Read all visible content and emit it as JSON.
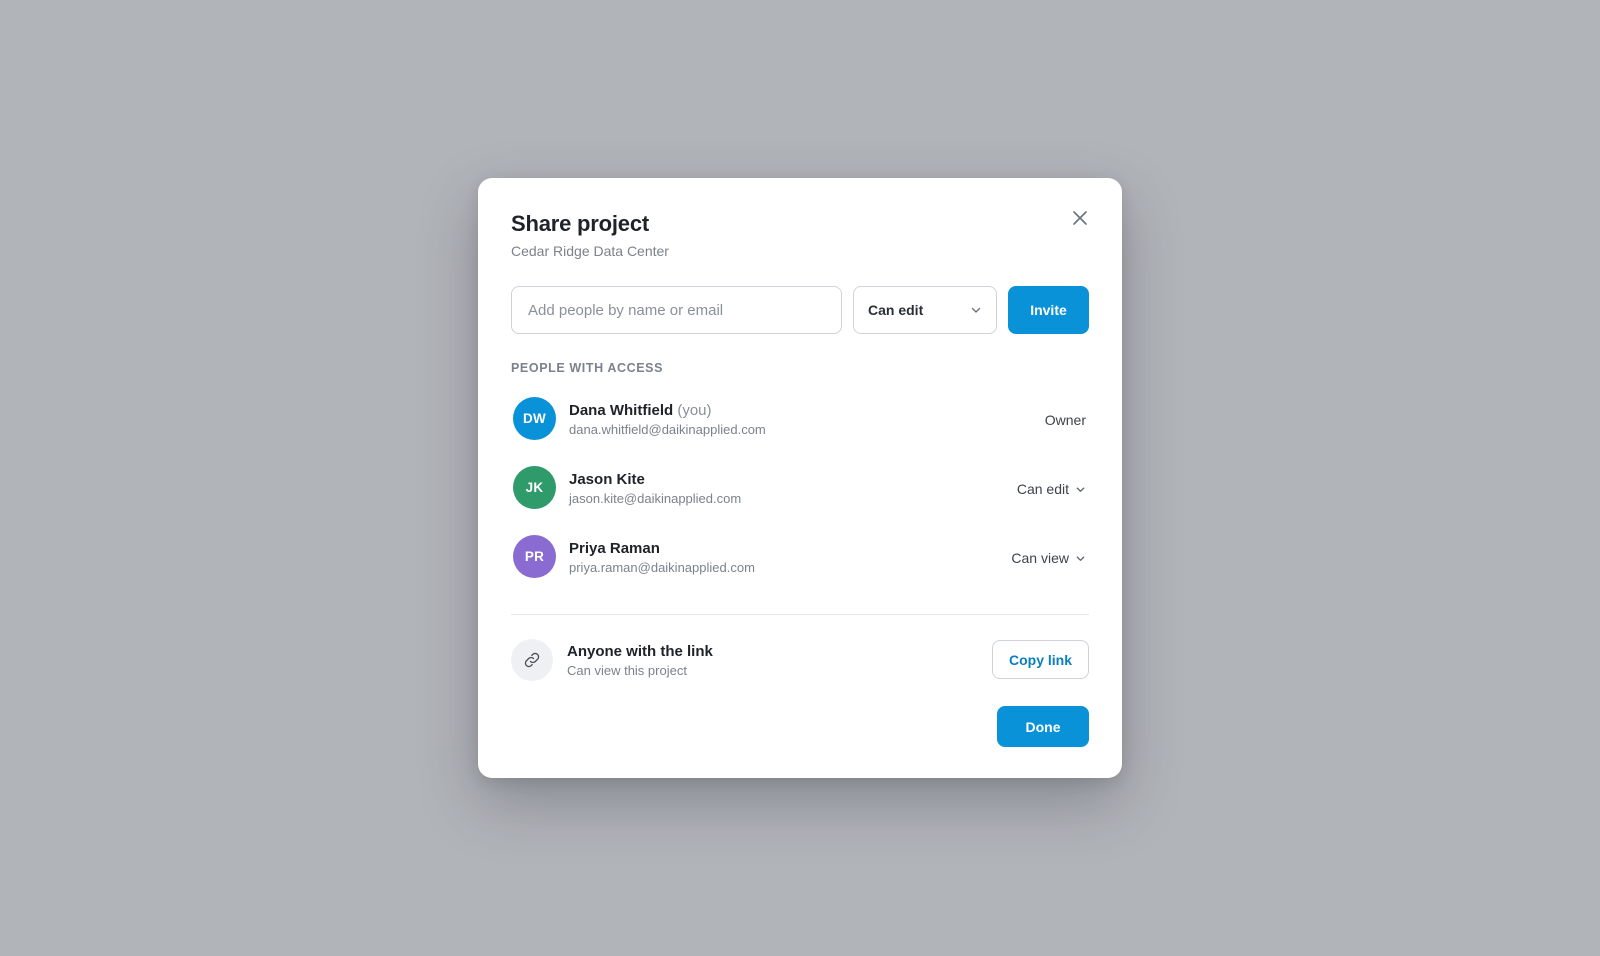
{
  "dialog": {
    "title": "Share project",
    "subtitle": "Cedar Ridge Data Center"
  },
  "invite": {
    "placeholder": "Add people by name or email",
    "value": "",
    "role_selected": "Can edit",
    "button_label": "Invite"
  },
  "access": {
    "section_label": "PEOPLE WITH ACCESS",
    "people": [
      {
        "initials": "DW",
        "name": "Dana Whitfield",
        "you_suffix": "(you)",
        "email": "dana.whitfield@daikinapplied.com",
        "role": "Owner",
        "avatar_color": "#0a92d8"
      },
      {
        "initials": "JK",
        "name": "Jason Kite",
        "email": "jason.kite@daikinapplied.com",
        "role": "Can edit",
        "avatar_color": "#2f9a6a"
      },
      {
        "initials": "PR",
        "name": "Priya Raman",
        "email": "priya.raman@daikinapplied.com",
        "role": "Can view",
        "avatar_color": "#8a6bd1"
      }
    ]
  },
  "link_sharing": {
    "title": "Anyone with the link",
    "subtitle": "Can view this project",
    "copy_button_label": "Copy link",
    "icon": "link-icon"
  },
  "footer": {
    "done_label": "Done"
  },
  "colors": {
    "backdrop": "#b1b4b9",
    "primary": "#0a92d8",
    "link_text": "#0a7fbf"
  }
}
